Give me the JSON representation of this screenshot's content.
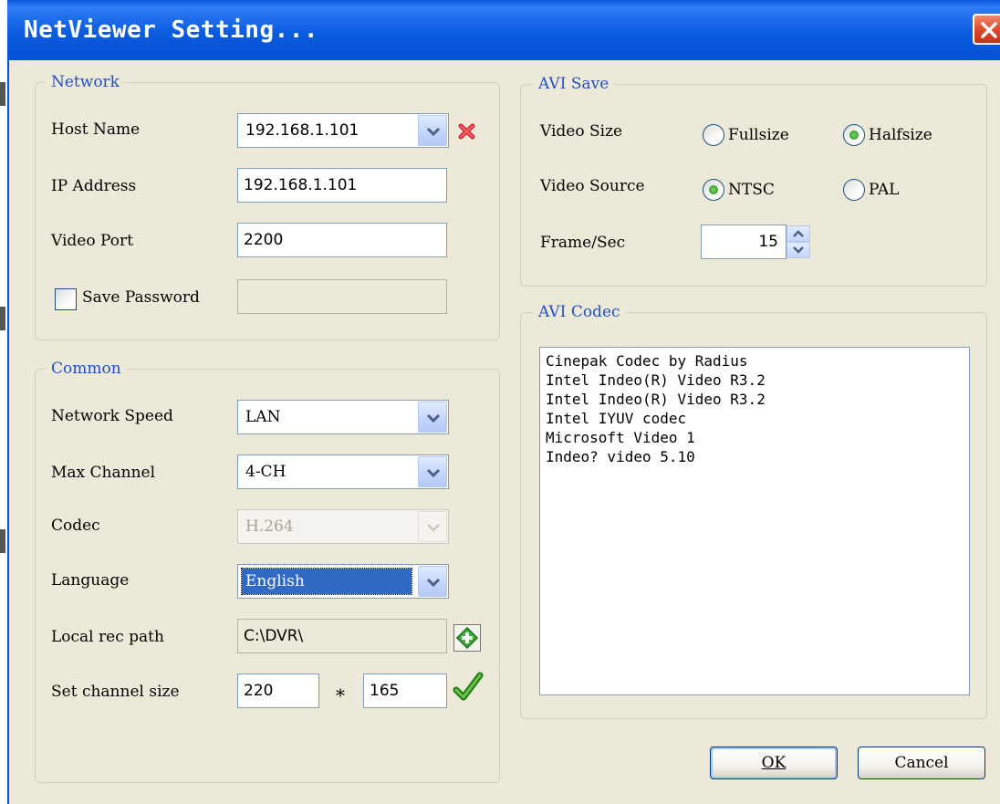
{
  "window": {
    "title": "NetViewer Setting..."
  },
  "network": {
    "legend": "Network",
    "host_name_label": "Host Name",
    "host_name_value": "192.168.1.101",
    "ip_label": "IP Address",
    "ip_value": "192.168.1.101",
    "port_label": "Video Port",
    "port_value": "2200",
    "save_password_label": "Save Password",
    "save_password_checked": false
  },
  "common": {
    "legend": "Common",
    "speed_label": "Network Speed",
    "speed_value": "LAN",
    "max_channel_label": "Max Channel",
    "max_channel_value": "4-CH",
    "codec_label": "Codec",
    "codec_value": "H.264",
    "language_label": "Language",
    "language_value": "English",
    "rec_path_label": "Local rec path",
    "rec_path_value": "C:\\DVR\\",
    "channel_size_label": "Set channel size",
    "channel_width": "220",
    "times": "*",
    "channel_height": "165"
  },
  "avi_save": {
    "legend": "AVI Save",
    "video_size_label": "Video Size",
    "fullsize_label": "Fullsize",
    "halfsize_label": "Halfsize",
    "video_size_selected": "Halfsize",
    "video_source_label": "Video Source",
    "ntsc_label": "NTSC",
    "pal_label": "PAL",
    "video_source_selected": "NTSC",
    "fps_label": "Frame/Sec",
    "fps_value": "15"
  },
  "avi_codec": {
    "legend": "AVI Codec",
    "items": [
      "Cinepak Codec by Radius",
      "Intel Indeo(R) Video R3.2",
      "Intel Indeo(R) Video R3.2",
      "Intel IYUV codec",
      "Microsoft Video 1",
      "Indeo? video 5.10"
    ]
  },
  "buttons": {
    "ok": "OK",
    "cancel": "Cancel"
  },
  "colors": {
    "titlebar": "#0552d6",
    "dialog_bg": "#ece9d8",
    "legend_text": "#2050c8"
  }
}
